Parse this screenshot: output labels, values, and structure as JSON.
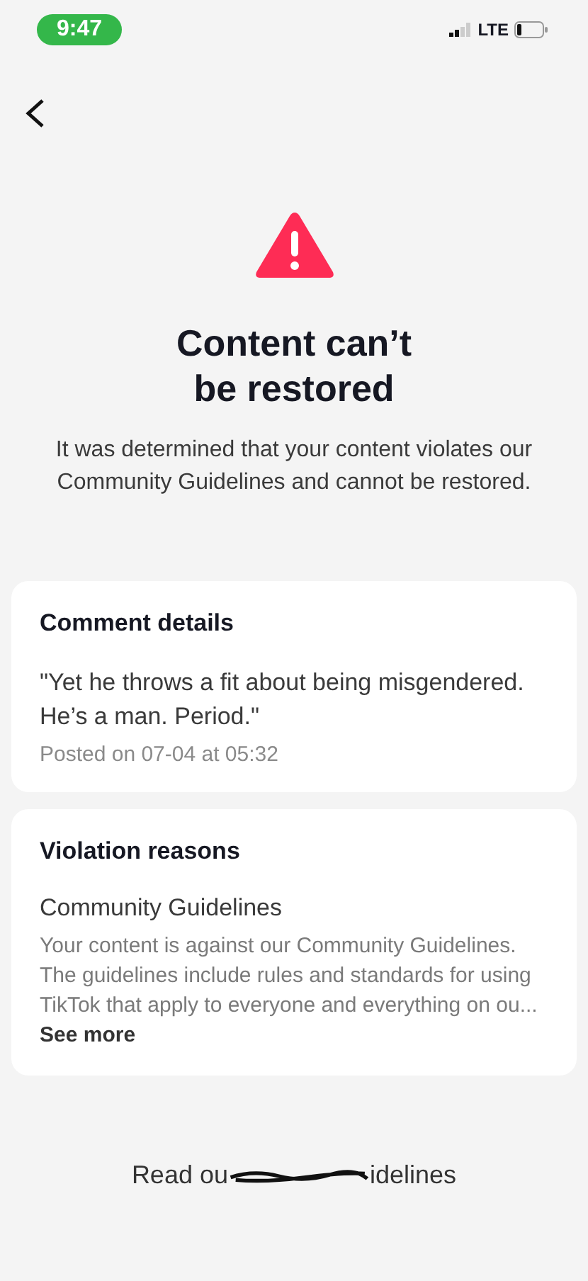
{
  "status_bar": {
    "time": "9:47",
    "network": "LTE"
  },
  "title": "Content can’t be restored",
  "description": "It was determined that your content violates our Community Guidelines and cannot be restored.",
  "cards": [
    {
      "kind": "comment",
      "heading": "Comment details",
      "quote": "\"Yet he throws a fit about being misgendered. He’s a man. Period.\"",
      "meta": "Posted on 07-04 at 05:32"
    },
    {
      "kind": "violation",
      "heading": "Violation reasons",
      "subheading": "Community Guidelines",
      "body": "Your content is against our Community Guidelines. The guidelines include rules and standards for using TikTok that apply to everyone and everything on ou...",
      "more": "See more"
    }
  ],
  "footer_link": {
    "visible_start": "Read ou",
    "visible_end": "idelines"
  }
}
